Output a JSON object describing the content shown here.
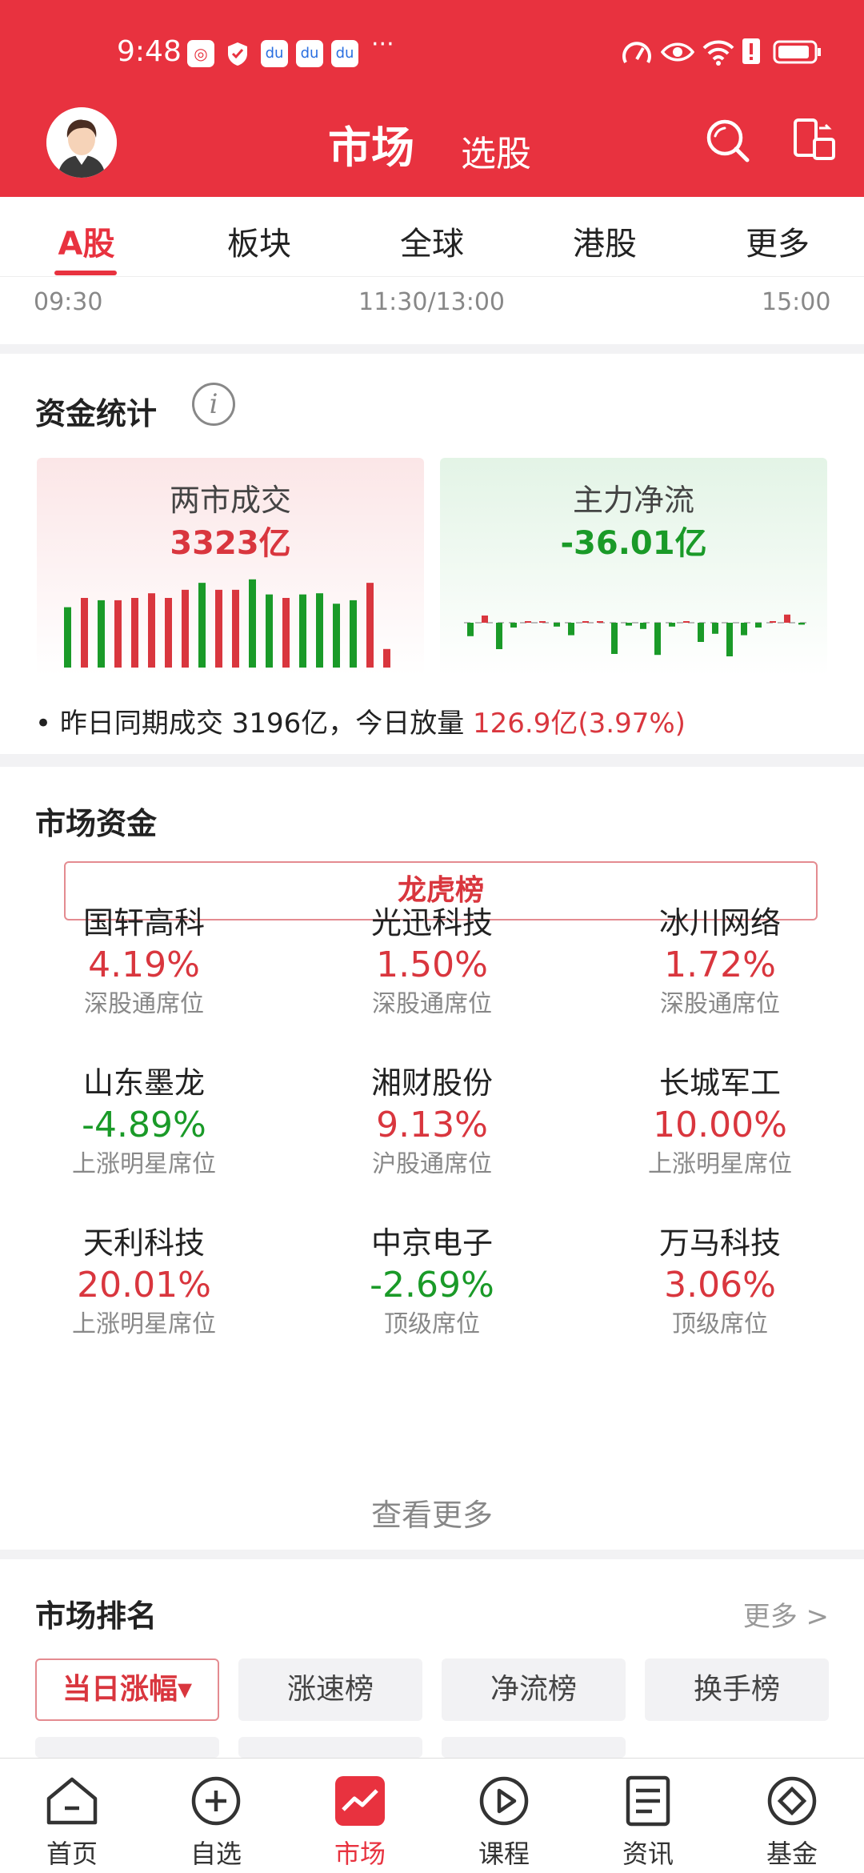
{
  "status_bar": {
    "time": "9:48",
    "more": "···"
  },
  "header": {
    "title": "市场",
    "subtitle": "选股",
    "search_icon": "search-icon",
    "switch_icon": "phone-switch-icon"
  },
  "tabs": [
    {
      "label": "A股",
      "active": true
    },
    {
      "label": "板块"
    },
    {
      "label": "全球"
    },
    {
      "label": "港股"
    },
    {
      "label": "更多"
    }
  ],
  "time_axis": {
    "start": "09:30",
    "mid": "11:30/13:00",
    "end": "15:00"
  },
  "fund_stats": {
    "title": "资金统计",
    "info_glyph": "i",
    "turnover": {
      "label": "两市成交",
      "value": "3323亿"
    },
    "net_flow": {
      "label": "主力净流",
      "value": "-36.01亿"
    },
    "yesterday_text": "昨日同期成交 3196亿，今日放量 ",
    "yesterday_highlight": "126.9亿(3.97%)",
    "turnover_bars": [
      {
        "h": 0.52,
        "c": "g"
      },
      {
        "h": 0.6,
        "c": "r"
      },
      {
        "h": 0.58,
        "c": "g"
      },
      {
        "h": 0.58,
        "c": "r"
      },
      {
        "h": 0.6,
        "c": "r"
      },
      {
        "h": 0.64,
        "c": "r"
      },
      {
        "h": 0.6,
        "c": "r"
      },
      {
        "h": 0.67,
        "c": "r"
      },
      {
        "h": 0.73,
        "c": "g"
      },
      {
        "h": 0.67,
        "c": "r"
      },
      {
        "h": 0.67,
        "c": "r"
      },
      {
        "h": 0.76,
        "c": "g"
      },
      {
        "h": 0.63,
        "c": "g"
      },
      {
        "h": 0.6,
        "c": "r"
      },
      {
        "h": 0.63,
        "c": "g"
      },
      {
        "h": 0.64,
        "c": "g"
      },
      {
        "h": 0.55,
        "c": "g"
      },
      {
        "h": 0.58,
        "c": "g"
      },
      {
        "h": 0.73,
        "c": "r"
      },
      {
        "h": 0.16,
        "c": "r"
      }
    ],
    "net_flow_bars": [
      -0.28,
      0.15,
      -0.55,
      -0.1,
      0.01,
      0.01,
      -0.08,
      -0.26,
      0.01,
      0.01,
      -0.65,
      -0.06,
      -0.13,
      -0.67,
      -0.08,
      0.01,
      -0.4,
      -0.23,
      -0.7,
      -0.26,
      -0.1,
      0.03,
      0.17,
      -0.04
    ]
  },
  "market_funds": {
    "title": "市场资金",
    "button_label": "龙虎榜",
    "stocks": [
      {
        "name": "国轩高科",
        "pct": "4.19%",
        "seat": "深股通席位",
        "dir": "up"
      },
      {
        "name": "光迅科技",
        "pct": "1.50%",
        "seat": "深股通席位",
        "dir": "up"
      },
      {
        "name": "冰川网络",
        "pct": "1.72%",
        "seat": "深股通席位",
        "dir": "up"
      },
      {
        "name": "山东墨龙",
        "pct": "-4.89%",
        "seat": "上涨明星席位",
        "dir": "down"
      },
      {
        "name": "湘财股份",
        "pct": "9.13%",
        "seat": "沪股通席位",
        "dir": "up"
      },
      {
        "name": "长城军工",
        "pct": "10.00%",
        "seat": "上涨明星席位",
        "dir": "up"
      },
      {
        "name": "天利科技",
        "pct": "20.01%",
        "seat": "上涨明星席位",
        "dir": "up"
      },
      {
        "name": "中京电子",
        "pct": "-2.69%",
        "seat": "顶级席位",
        "dir": "down"
      },
      {
        "name": "万马科技",
        "pct": "3.06%",
        "seat": "顶级席位",
        "dir": "up"
      }
    ],
    "see_more": "查看更多"
  },
  "market_rank": {
    "title": "市场排名",
    "more": "更多 >",
    "chips": [
      "当日涨幅▾",
      "涨速榜",
      "净流榜",
      "换手榜"
    ]
  },
  "bottom_nav": [
    {
      "label": "首页",
      "icon": "home-icon"
    },
    {
      "label": "自选",
      "icon": "plus-circle-icon"
    },
    {
      "label": "市场",
      "icon": "market-chart-icon",
      "active": true
    },
    {
      "label": "课程",
      "icon": "play-circle-icon"
    },
    {
      "label": "资讯",
      "icon": "news-icon"
    },
    {
      "label": "基金",
      "icon": "fund-diamond-icon"
    }
  ],
  "colors": {
    "brand_red": "#e8323f",
    "up_red": "#d9363e",
    "down_green": "#1a9a28"
  }
}
